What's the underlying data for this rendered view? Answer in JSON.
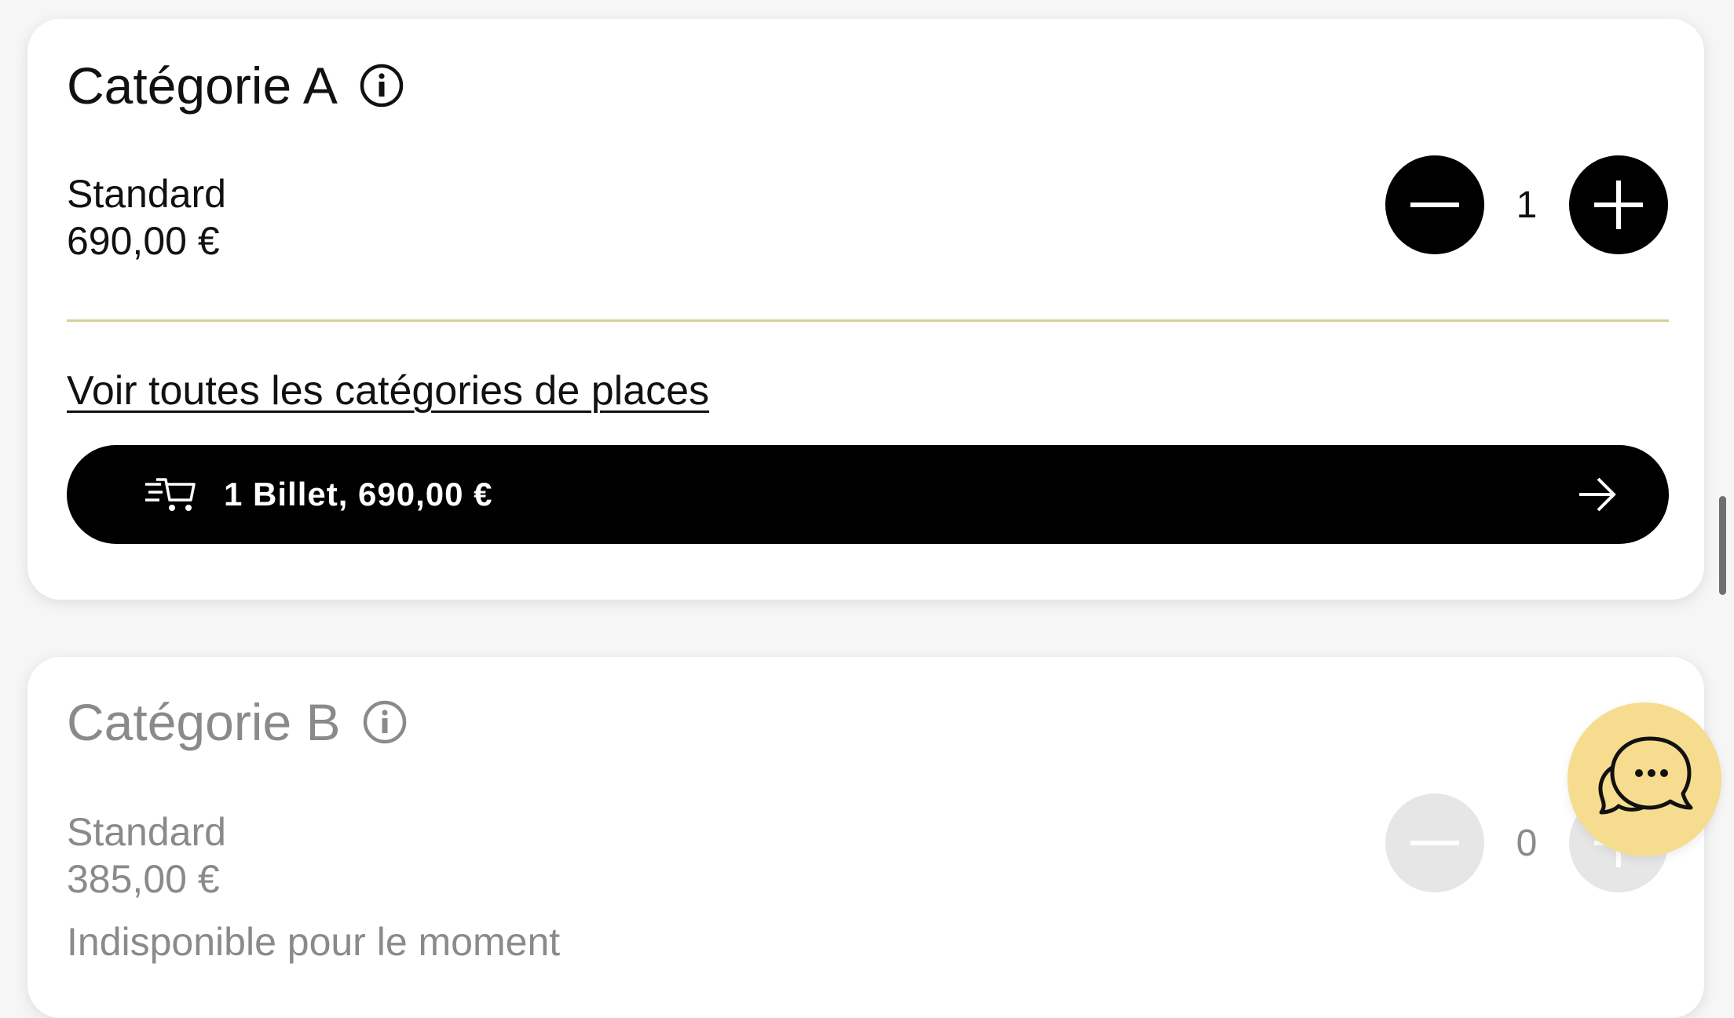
{
  "categories": [
    {
      "title": "Catégorie A",
      "ticket_name": "Standard",
      "price": "690,00 €",
      "quantity": "1",
      "available": true
    },
    {
      "title": "Catégorie B",
      "ticket_name": "Standard",
      "price": "385,00 €",
      "quantity": "0",
      "available": false,
      "status": "Indisponible pour le moment"
    }
  ],
  "see_all_link": "Voir toutes les catégories de places",
  "cart_button": {
    "label": "1 Billet, 690,00 €"
  },
  "icons": {
    "info": "info-icon",
    "minus": "minus-icon",
    "plus": "plus-icon",
    "cart": "fast-cart-icon",
    "arrow": "arrow-right-icon",
    "chat": "chat-bubbles-icon"
  },
  "colors": {
    "accent_divider": "#d4d09c",
    "chat_button": "#f6dc8f",
    "primary_button": "#000000",
    "disabled_button": "#e6e6e6",
    "disabled_text": "#8a8a8a"
  }
}
